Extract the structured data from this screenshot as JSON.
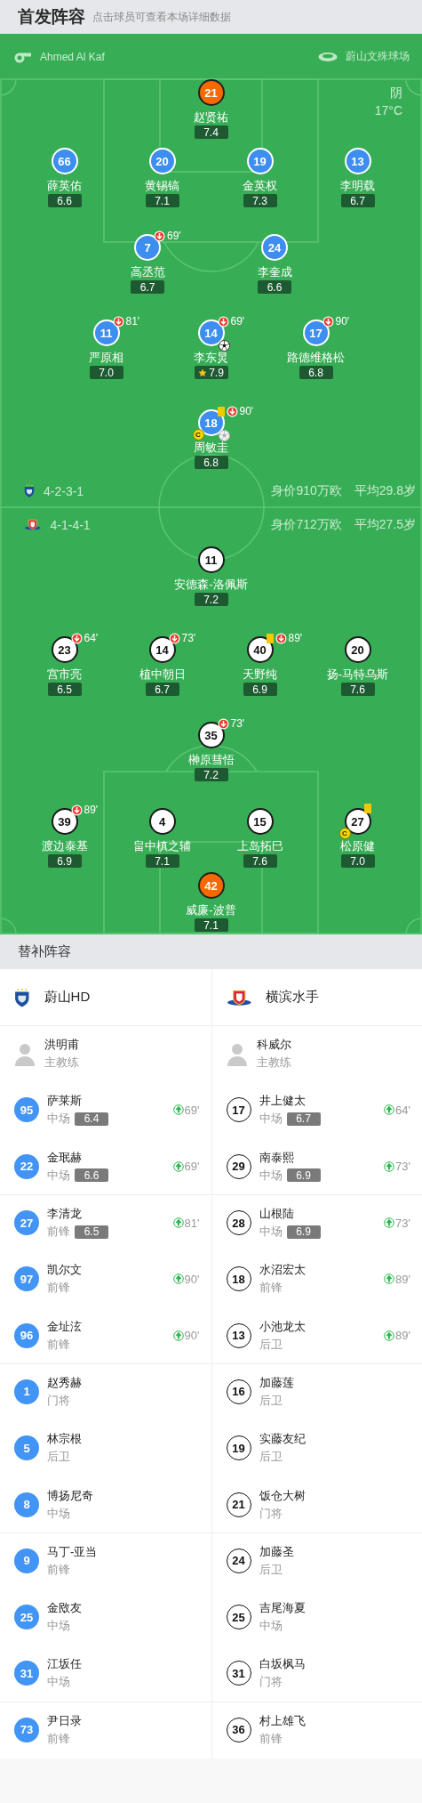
{
  "header": {
    "title": "首发阵容",
    "hint": "点击球员可查看本场详细数据"
  },
  "pitch": {
    "referee": "Ahmed Al Kaf",
    "stadium": "蔚山文殊球场",
    "weather": "阴",
    "temperature": "17°C"
  },
  "teams": [
    {
      "kind": "home",
      "formation": "4-2-3-1",
      "market_value": "身价910万欧",
      "average_age": "平均29.8岁",
      "rows": [
        [
          {
            "number": "21",
            "name": "赵贤祐",
            "rating": "7.4",
            "kind": "goalkeeper",
            "yellow_card": false,
            "mvp": false
          }
        ],
        [
          {
            "number": "66",
            "name": "薛英佑",
            "rating": "6.6",
            "kind": "outfield",
            "yellow_card": false,
            "mvp": false
          },
          {
            "number": "20",
            "name": "黄锡镐",
            "rating": "7.1",
            "kind": "outfield",
            "yellow_card": false,
            "mvp": false
          },
          {
            "number": "19",
            "name": "金英权",
            "rating": "7.3",
            "kind": "outfield",
            "yellow_card": false,
            "mvp": false
          },
          {
            "number": "13",
            "name": "李明载",
            "rating": "6.7",
            "kind": "outfield",
            "yellow_card": false,
            "mvp": false
          }
        ],
        [
          {
            "number": "7",
            "name": "高丞范",
            "rating": "6.7",
            "kind": "outfield",
            "yellow_card": false,
            "mvp": false,
            "sub_off": "69'"
          },
          {
            "number": "24",
            "name": "李奎成",
            "rating": "6.6",
            "kind": "outfield",
            "yellow_card": false,
            "mvp": false
          }
        ],
        [
          {
            "number": "11",
            "name": "严原相",
            "rating": "7.0",
            "kind": "outfield",
            "yellow_card": false,
            "mvp": false,
            "sub_off": "81'"
          },
          {
            "number": "14",
            "name": "李东炅",
            "rating": "7.9",
            "kind": "outfield",
            "yellow_card": false,
            "mvp": true,
            "sub_off": "69'",
            "ball": {
              "kind": "dark"
            }
          },
          {
            "number": "17",
            "name": "路德维格松",
            "rating": "6.8",
            "kind": "outfield",
            "yellow_card": false,
            "mvp": false,
            "sub_off": "90'"
          }
        ],
        [
          {
            "number": "18",
            "name": "周敏圭",
            "rating": "6.8",
            "kind": "outfield",
            "yellow_card": true,
            "mvp": false,
            "sub_off": "90'",
            "armband": "C",
            "ball": {
              "kind": "light"
            }
          }
        ]
      ]
    },
    {
      "kind": "away",
      "formation": "4-1-4-1",
      "market_value": "身价712万欧",
      "average_age": "平均27.5岁",
      "rows": [
        [
          {
            "number": "11",
            "name": "安德森-洛佩斯",
            "rating": "7.2",
            "kind": "outfield",
            "yellow_card": false,
            "mvp": false
          }
        ],
        [
          {
            "number": "23",
            "name": "宫市亮",
            "rating": "6.5",
            "kind": "outfield",
            "yellow_card": false,
            "mvp": false,
            "sub_off": "64'"
          },
          {
            "number": "14",
            "name": "植中朝日",
            "rating": "6.7",
            "kind": "outfield",
            "yellow_card": false,
            "mvp": false,
            "sub_off": "73'"
          },
          {
            "number": "40",
            "name": "天野纯",
            "rating": "6.9",
            "kind": "outfield",
            "yellow_card": true,
            "mvp": false,
            "sub_off": "89'"
          },
          {
            "number": "20",
            "name": "扬-马特乌斯",
            "rating": "7.6",
            "kind": "outfield",
            "yellow_card": false,
            "mvp": false
          }
        ],
        [
          {
            "number": "35",
            "name": "榊原彗悟",
            "rating": "7.2",
            "kind": "outfield",
            "yellow_card": false,
            "mvp": false,
            "sub_off": "73'"
          }
        ],
        [
          {
            "number": "39",
            "name": "渡边泰基",
            "rating": "6.9",
            "kind": "outfield",
            "yellow_card": false,
            "mvp": false,
            "sub_off": "89'"
          },
          {
            "number": "4",
            "name": "畠中槙之辅",
            "rating": "7.1",
            "kind": "outfield",
            "yellow_card": false,
            "mvp": false
          },
          {
            "number": "15",
            "name": "上岛拓巳",
            "rating": "7.6",
            "kind": "outfield",
            "yellow_card": false,
            "mvp": false
          },
          {
            "number": "27",
            "name": "松原健",
            "rating": "7.0",
            "kind": "outfield",
            "yellow_card": true,
            "mvp": false,
            "armband": "C"
          }
        ],
        [
          {
            "number": "42",
            "name": "威廉-波普",
            "rating": "7.1",
            "kind": "goalkeeper",
            "yellow_card": false,
            "mvp": false
          }
        ]
      ]
    }
  ],
  "subs_title": "替补阵容",
  "squads": [
    {
      "kind": "home",
      "team": "蔚山HD",
      "coach": {
        "name": "洪明甫",
        "role": "主教练"
      },
      "players": [
        {
          "number": "95",
          "name": "萨莱斯",
          "position": "中场",
          "rating": "6.4",
          "sub_on": "69'"
        },
        {
          "number": "22",
          "name": "金珉赫",
          "position": "中场",
          "rating": "6.6",
          "sub_on": "69'"
        },
        {
          "number": "27",
          "name": "李清龙",
          "position": "前锋",
          "rating": "6.5",
          "sub_on": "81'"
        },
        {
          "number": "97",
          "name": "凯尔文",
          "position": "前锋",
          "sub_on": "90'"
        },
        {
          "number": "96",
          "name": "金址泫",
          "position": "前锋",
          "sub_on": "90'"
        },
        {
          "number": "1",
          "name": "赵秀赫",
          "position": "门将"
        },
        {
          "number": "5",
          "name": "林宗根",
          "position": "后卫"
        },
        {
          "number": "8",
          "name": "博扬尼奇",
          "position": "中场"
        },
        {
          "number": "9",
          "name": "马丁-亚当",
          "position": "前锋"
        },
        {
          "number": "25",
          "name": "金敃友",
          "position": "中场"
        },
        {
          "number": "31",
          "name": "江坂任",
          "position": "中场"
        },
        {
          "number": "73",
          "name": "尹日录",
          "position": "前锋"
        }
      ]
    },
    {
      "kind": "away",
      "team": "横滨水手",
      "coach": {
        "name": "科威尔",
        "role": "主教练"
      },
      "players": [
        {
          "number": "17",
          "name": "井上健太",
          "position": "中场",
          "rating": "6.7",
          "sub_on": "64'"
        },
        {
          "number": "29",
          "name": "南泰熙",
          "position": "中场",
          "rating": "6.9",
          "sub_on": "73'"
        },
        {
          "number": "28",
          "name": "山根陆",
          "position": "中场",
          "rating": "6.9",
          "sub_on": "73'"
        },
        {
          "number": "18",
          "name": "水沼宏太",
          "position": "前锋",
          "sub_on": "89'"
        },
        {
          "number": "13",
          "name": "小池龙太",
          "position": "后卫",
          "sub_on": "89'"
        },
        {
          "number": "16",
          "name": "加藤莲",
          "position": "后卫"
        },
        {
          "number": "19",
          "name": "实藤友纪",
          "position": "后卫"
        },
        {
          "number": "21",
          "name": "饭仓大树",
          "position": "门将"
        },
        {
          "number": "24",
          "name": "加藤圣",
          "position": "后卫"
        },
        {
          "number": "25",
          "name": "吉尾海夏",
          "position": "中场"
        },
        {
          "number": "31",
          "name": "白坂枫马",
          "position": "门将"
        },
        {
          "number": "36",
          "name": "村上雄飞",
          "position": "前锋"
        }
      ]
    }
  ]
}
